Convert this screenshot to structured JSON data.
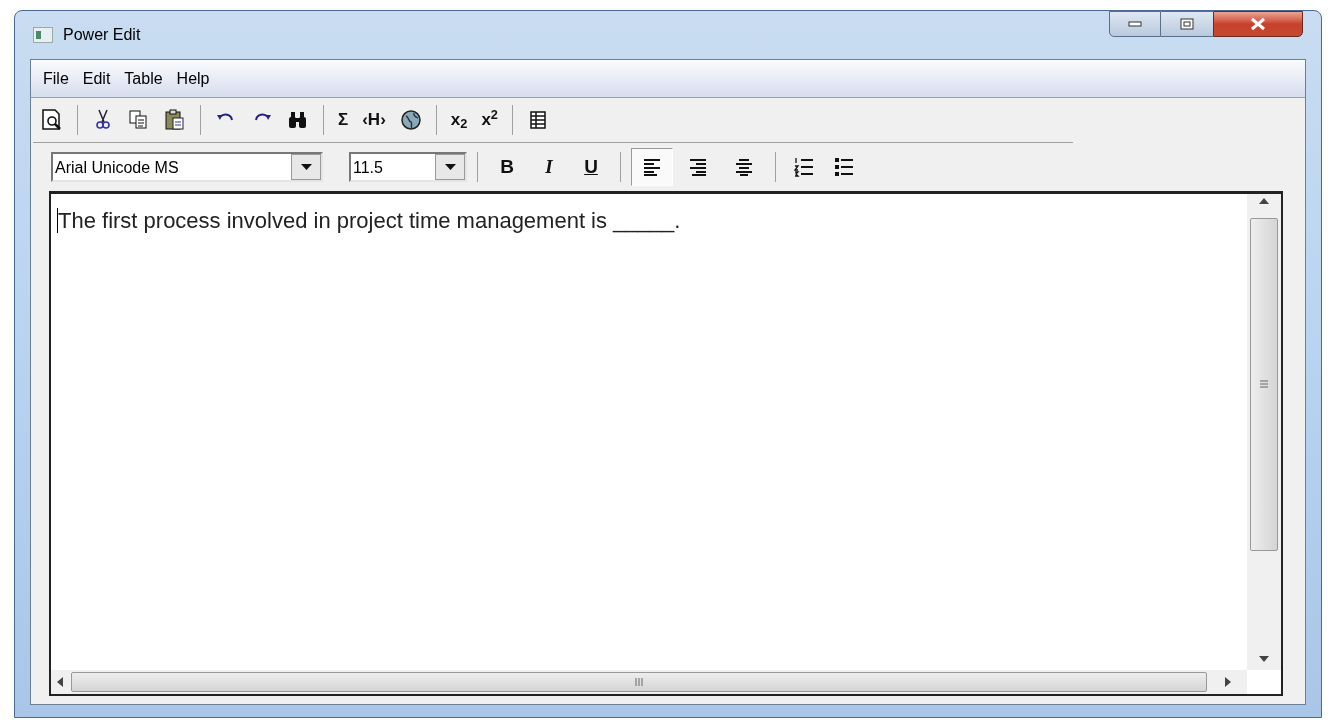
{
  "window": {
    "title": "Power Edit"
  },
  "menu": [
    "File",
    "Edit",
    "Table",
    "Help"
  ],
  "toolbar": [
    [
      {
        "kind": "preview"
      }
    ],
    [
      {
        "kind": "cut"
      },
      {
        "kind": "copy"
      },
      {
        "kind": "paste"
      }
    ],
    [
      {
        "kind": "undo"
      },
      {
        "kind": "redo"
      },
      {
        "kind": "find"
      }
    ],
    [
      {
        "kind": "glyph",
        "label": "Σ"
      },
      {
        "kind": "glyph",
        "label": "‹H›"
      },
      {
        "kind": "globe"
      }
    ],
    [
      {
        "kind": "glyph",
        "label": "x$_{2}$"
      },
      {
        "kind": "glyph",
        "label": "x$^{2}$"
      }
    ],
    [
      {
        "kind": "table"
      }
    ]
  ],
  "format_bar": {
    "font": "Arial Unicode MS",
    "size": "11.5",
    "styles": [
      {
        "kind": "bold",
        "label": "B"
      },
      {
        "kind": "italic",
        "label": "I"
      },
      {
        "kind": "underline",
        "label": "U"
      }
    ],
    "align": [
      {
        "kind": "left",
        "selected": true
      },
      {
        "kind": "right",
        "selected": false
      },
      {
        "kind": "center",
        "selected": false
      }
    ],
    "lists": [
      {
        "kind": "numbered"
      },
      {
        "kind": "bulleted"
      }
    ]
  },
  "editor": {
    "text": "The first process involved in project time management is _____."
  }
}
